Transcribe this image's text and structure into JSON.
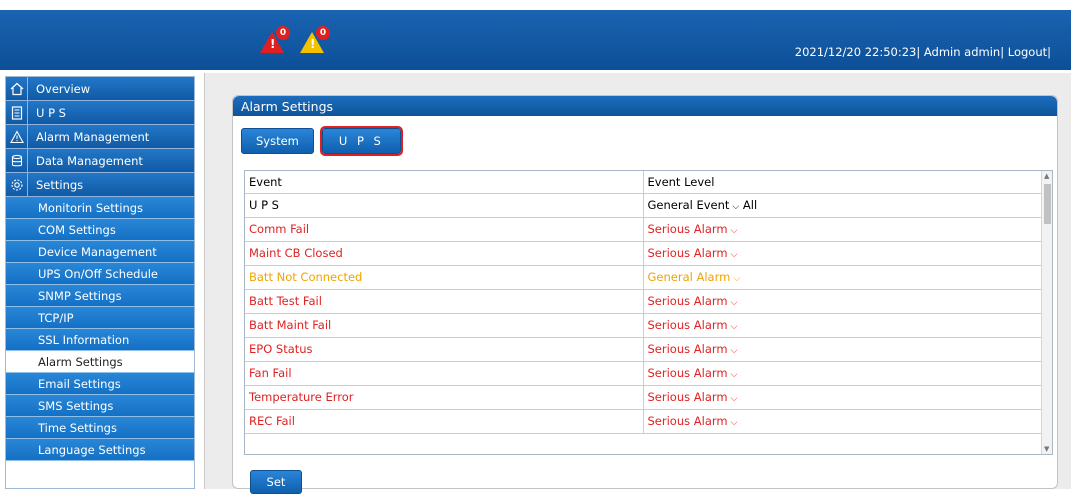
{
  "header": {
    "alarms": {
      "serious_count": "0",
      "general_count": "0"
    },
    "datetime": "2021/12/20 22:50:23|",
    "user": "Admin admin|",
    "logout": "Logout|"
  },
  "sidebar": {
    "main": [
      {
        "label": "Overview",
        "icon": "home-icon"
      },
      {
        "label": "U P S",
        "icon": "ups-icon"
      },
      {
        "label": "Alarm Management",
        "icon": "warning-icon"
      },
      {
        "label": "Data Management",
        "icon": "database-icon"
      },
      {
        "label": "Settings",
        "icon": "gear-icon"
      }
    ],
    "settings_items": [
      "Monitorin Settings",
      "COM Settings",
      "Device Management",
      "UPS On/Off Schedule",
      "SNMP Settings",
      "TCP/IP",
      "SSL Information",
      "Alarm Settings",
      "Email Settings",
      "SMS Settings",
      "Time Settings",
      "Language Settings"
    ],
    "active_item": "Alarm Settings"
  },
  "panel": {
    "title": "Alarm Settings",
    "tabs": [
      "System",
      "U P S"
    ],
    "selected_tab": "U P S"
  },
  "table": {
    "columns": [
      "Event",
      "Event Level"
    ],
    "group_row": {
      "event": "U P S",
      "level": "General Event",
      "filter": "All"
    },
    "rows": [
      {
        "event": "Comm Fail",
        "level": "Serious Alarm",
        "color": "#e02222"
      },
      {
        "event": "Maint CB Closed",
        "level": "Serious Alarm",
        "color": "#e02222"
      },
      {
        "event": "Batt Not Connected",
        "level": "General Alarm",
        "color": "#f0a400"
      },
      {
        "event": "Batt Test Fail",
        "level": "Serious Alarm",
        "color": "#e02222"
      },
      {
        "event": "Batt Maint Fail",
        "level": "Serious Alarm",
        "color": "#e02222"
      },
      {
        "event": "EPO Status",
        "level": "Serious Alarm",
        "color": "#e02222"
      },
      {
        "event": "Fan Fail",
        "level": "Serious Alarm",
        "color": "#e02222"
      },
      {
        "event": "Temperature Error",
        "level": "Serious Alarm",
        "color": "#e02222"
      },
      {
        "event": "REC Fail",
        "level": "Serious Alarm",
        "color": "#e02222"
      }
    ]
  },
  "actions": {
    "set_label": "Set"
  }
}
